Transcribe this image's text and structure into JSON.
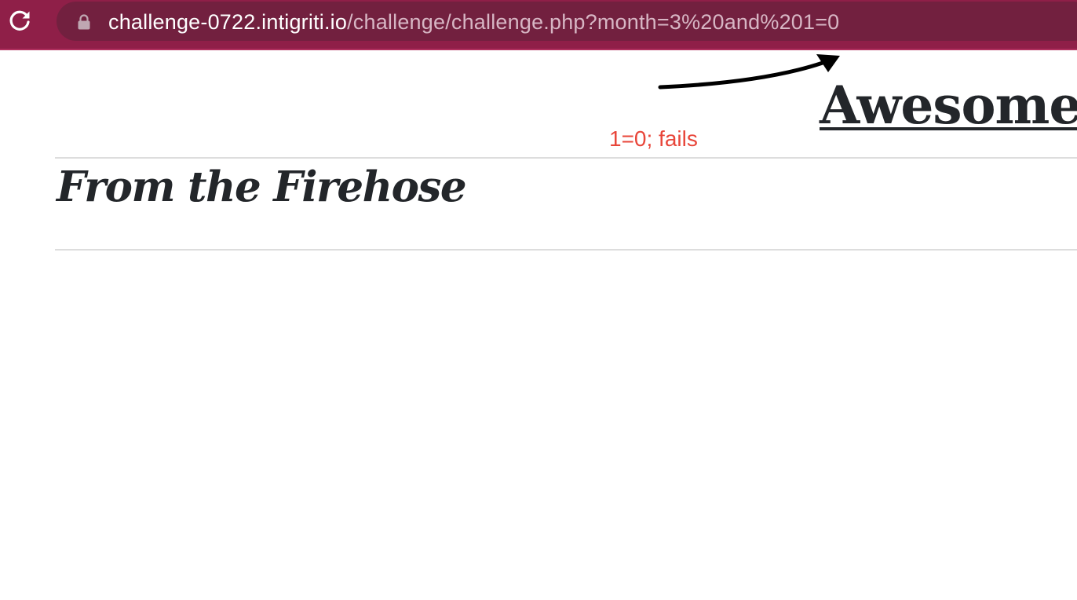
{
  "browser": {
    "url_host": "challenge-0722.intigriti.io",
    "url_path": "/challenge/challenge.php?month=3%20and%201=0",
    "reload_icon": "reload-icon",
    "lock_icon": "lock-icon",
    "toolbar_color": "#8f1f48",
    "omnibox_color": "#72203f"
  },
  "annotation": {
    "text": "1=0; fails",
    "color": "#e8463a",
    "arrow_icon": "arrow-icon"
  },
  "page": {
    "site_title": "Awesome",
    "section_heading": "From the Firehose"
  }
}
